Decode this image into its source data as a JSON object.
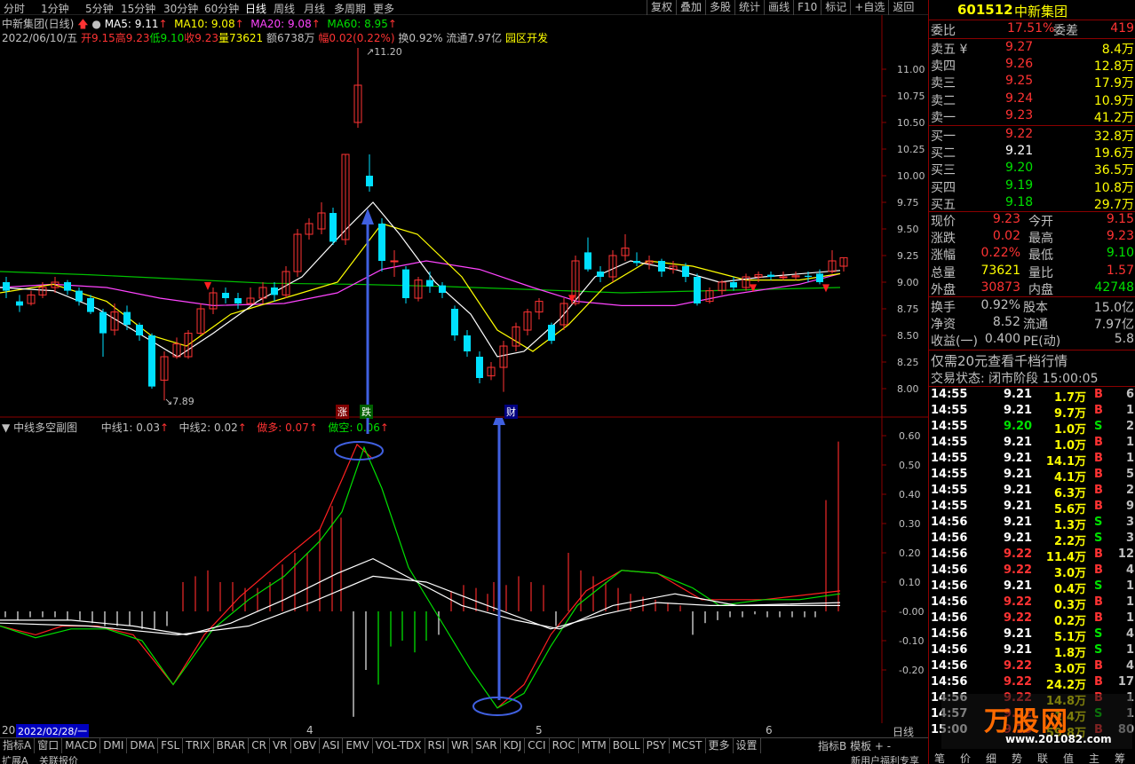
{
  "topbar": {
    "tabs": [
      "分时",
      "1分钟",
      "5分钟",
      "15分钟",
      "30分钟",
      "60分钟",
      "日线",
      "周线",
      "月线",
      "多周期",
      "更多"
    ],
    "active": "日线",
    "right_tools": [
      "复权",
      "叠加",
      "多股",
      "统计",
      "画线",
      "F10",
      "标记",
      "+自选",
      "返回"
    ]
  },
  "info": {
    "stock_label": "中新集团(日线)",
    "ma5": "MA5: 9.11",
    "ma10": "MA10: 9.08",
    "ma20": "MA20: 9.08",
    "ma60": "MA60: 8.95",
    "date": "2022/06/10/五",
    "open": "开9.15",
    "high": "高9.23",
    "low": "低9.10",
    "close": "收9.23",
    "vol": "量73621",
    "amount": "额6738万",
    "amp": "幅0.02(0.22%)",
    "turnover": "换0.92%",
    "float_cap": "流通7.97亿",
    "sector": "园区开发"
  },
  "main_chart": {
    "price_labels": [
      "11.00",
      "10.75",
      "10.50",
      "10.25",
      "10.00",
      "9.75",
      "9.50",
      "9.25",
      "9.00",
      "8.75",
      "8.50",
      "8.25",
      "8.00"
    ],
    "high_mark": "11.20",
    "low_mark": "7.89",
    "tag_zhang": "涨",
    "tag_die": "跌",
    "tag_cai": "财"
  },
  "sub_chart": {
    "title": "中线多空副图",
    "zx1": "中线1: 0.03",
    "zx2": "中线2: 0.02",
    "zuoduo": "做多: 0.07",
    "zuokong": "做空: 0.06",
    "labels": [
      "0.60",
      "0.50",
      "0.40",
      "0.30",
      "0.20",
      "0.10",
      "-0.00",
      "-0.10",
      "-0.20"
    ]
  },
  "datebar": {
    "left_num": "20",
    "date_box": "2022/02/28/一",
    "ticks": [
      "4",
      "5",
      "6"
    ],
    "period": "日线"
  },
  "index_tabs": [
    "指标A",
    "窗口",
    "MACD",
    "DMI",
    "DMA",
    "FSL",
    "TRIX",
    "BRAR",
    "CR",
    "VR",
    "OBV",
    "ASI",
    "EMV",
    "VOL-TDX",
    "RSI",
    "WR",
    "SAR",
    "KDJ",
    "CCI",
    "ROC",
    "MTM",
    "BOLL",
    "PSY",
    "MCST",
    "更多",
    "设置"
  ],
  "index_right": [
    "指标B",
    "模板",
    "+",
    "-"
  ],
  "status": {
    "left": "扩展A",
    "left2": "关联报价",
    "right": "新用户福利专享"
  },
  "panel": {
    "code": "601512",
    "name": "中新集团",
    "weibi_label": "委比",
    "weibi": "17.51%",
    "weicha_label": "委差",
    "weicha": "419",
    "asks": [
      {
        "label": "卖五 ¥",
        "price": "9.27",
        "vol": "8.4万"
      },
      {
        "label": "卖四",
        "price": "9.26",
        "vol": "12.8万"
      },
      {
        "label": "卖三",
        "price": "9.25",
        "vol": "17.9万"
      },
      {
        "label": "卖二",
        "price": "9.24",
        "vol": "10.9万"
      },
      {
        "label": "卖一",
        "price": "9.23",
        "vol": "41.2万"
      }
    ],
    "bids": [
      {
        "label": "买一",
        "price": "9.22",
        "vol": "32.8万",
        "color": "#ff3333"
      },
      {
        "label": "买二",
        "price": "9.21",
        "vol": "19.6万",
        "color": "#ffffff"
      },
      {
        "label": "买三",
        "price": "9.20",
        "vol": "36.5万",
        "color": "#00e000"
      },
      {
        "label": "买四",
        "price": "9.19",
        "vol": "10.8万",
        "color": "#00e000"
      },
      {
        "label": "买五",
        "price": "9.18",
        "vol": "29.7万",
        "color": "#00e000"
      }
    ],
    "quote": [
      {
        "l1": "现价",
        "v1": "9.23",
        "c1": "#ff3333",
        "l2": "今开",
        "v2": "9.15",
        "c2": "#ff3333"
      },
      {
        "l1": "涨跌",
        "v1": "0.02",
        "c1": "#ff3333",
        "l2": "最高",
        "v2": "9.23",
        "c2": "#ff3333"
      },
      {
        "l1": "涨幅",
        "v1": "0.22%",
        "c1": "#ff3333",
        "l2": "最低",
        "v2": "9.10",
        "c2": "#00e000"
      },
      {
        "l1": "总量",
        "v1": "73621",
        "c1": "#ffff00",
        "l2": "量比",
        "v2": "1.57",
        "c2": "#ff3333"
      },
      {
        "l1": "外盘",
        "v1": "30873",
        "c1": "#ff3333",
        "l2": "内盘",
        "v2": "42748",
        "c2": "#00e000"
      }
    ],
    "fund": [
      {
        "l1": "换手",
        "v1": "0.92%",
        "l2": "股本",
        "v2": "15.0亿"
      },
      {
        "l1": "净资",
        "v1": "8.52",
        "l2": "流通",
        "v2": "7.97亿"
      },
      {
        "l1": "收益(一)",
        "v1": "0.400",
        "l2": "PE(动)",
        "v2": "5.8"
      }
    ],
    "promo": "仅需20元查看千档行情",
    "trade_status": "交易状态: 闭市阶段 15:00:05",
    "ticks": [
      [
        "14:55",
        "9.21",
        "1.7万",
        "B",
        "6"
      ],
      [
        "14:55",
        "9.21",
        "9.7万",
        "B",
        "1"
      ],
      [
        "14:55",
        "9.20",
        "1.0万",
        "S",
        "2"
      ],
      [
        "14:55",
        "9.21",
        "1.0万",
        "B",
        "1"
      ],
      [
        "14:55",
        "9.21",
        "14.1万",
        "B",
        "1"
      ],
      [
        "14:55",
        "9.21",
        "4.1万",
        "B",
        "5"
      ],
      [
        "14:55",
        "9.21",
        "6.3万",
        "B",
        "2"
      ],
      [
        "14:55",
        "9.21",
        "5.6万",
        "B",
        "9"
      ],
      [
        "14:56",
        "9.21",
        "1.3万",
        "S",
        "3"
      ],
      [
        "14:56",
        "9.21",
        "2.2万",
        "S",
        "3"
      ],
      [
        "14:56",
        "9.22",
        "11.4万",
        "B",
        "12"
      ],
      [
        "14:56",
        "9.22",
        "3.0万",
        "B",
        "4"
      ],
      [
        "14:56",
        "9.21",
        "0.4万",
        "S",
        "1"
      ],
      [
        "14:56",
        "9.22",
        "0.3万",
        "B",
        "1"
      ],
      [
        "14:56",
        "9.22",
        "0.2万",
        "B",
        "1"
      ],
      [
        "14:56",
        "9.21",
        "5.1万",
        "S",
        "4"
      ],
      [
        "14:56",
        "9.21",
        "1.8万",
        "S",
        "1"
      ],
      [
        "14:56",
        "9.22",
        "3.0万",
        "B",
        "4"
      ],
      [
        "14:56",
        "9.22",
        "24.2万",
        "B",
        "17"
      ],
      [
        "14:56",
        "9.22",
        "14.8万",
        "B",
        "1"
      ],
      [
        "14:57",
        "9.22",
        "1.4万",
        "S",
        "1"
      ],
      [
        "15:00",
        "9.23",
        "59.8万",
        "B",
        "80"
      ]
    ],
    "bottom_tabs": [
      "笔",
      "价",
      "细",
      "势",
      "联",
      "值",
      "主",
      "筹"
    ]
  },
  "watermark": "www.201082.com",
  "colors": {
    "up": "#ff3333",
    "down": "#00e0ff",
    "ma5": "#ffffff",
    "ma10": "#ffff00",
    "ma20": "#ff44ff",
    "ma60": "#00c000"
  }
}
